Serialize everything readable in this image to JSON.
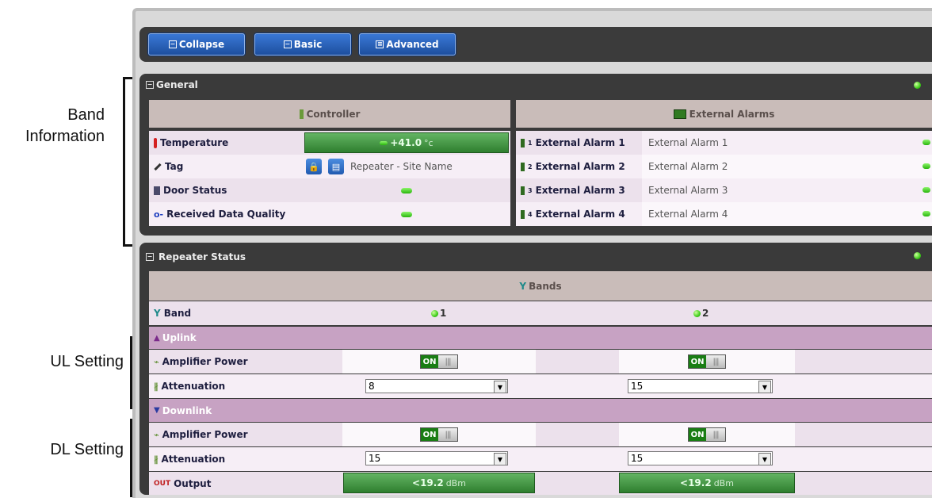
{
  "annotations": {
    "band_information": "Band\nInformation",
    "ul_setting": "UL Setting",
    "dl_setting": "DL Setting"
  },
  "toolbar": {
    "collapse_label": "Collapse",
    "basic_label": "Basic",
    "advanced_label": "Advanced"
  },
  "general": {
    "title": "General",
    "controller_header": "Controller",
    "external_alarms_header": "External Alarms",
    "temperature_label": "Temperature",
    "temperature_value": "+41.0",
    "temperature_unit": "°c",
    "tag_label": "Tag",
    "tag_value": "Repeater - Site Name",
    "door_status_label": "Door Status",
    "received_data_quality_label": "Received Data Quality",
    "alarms": [
      {
        "sup": "1",
        "label": "External Alarm 1",
        "value": "External Alarm 1"
      },
      {
        "sup": "2",
        "label": "External Alarm 2",
        "value": "External Alarm 2"
      },
      {
        "sup": "3",
        "label": "External Alarm 3",
        "value": "External Alarm 3"
      },
      {
        "sup": "4",
        "label": "External Alarm 4",
        "value": "External Alarm 4"
      }
    ]
  },
  "repeater": {
    "title": "Repeater Status",
    "bands_header": "Bands",
    "band_label": "Band",
    "band_1": "1",
    "band_2": "2",
    "uplink_label": "Uplink",
    "downlink_label": "Downlink",
    "ul_amp_label": "Amplifier Power",
    "ul_att_label": "Attenuation",
    "dl_amp_label": "Amplifier Power",
    "dl_att_label": "Attenuation",
    "output_label": "Output",
    "on_label": "ON",
    "ul_att_1": "8",
    "ul_att_2": "15",
    "dl_att_1": "15",
    "dl_att_2": "15",
    "output_1": "<19.2",
    "output_2": "<19.2",
    "output_unit": "dBm"
  },
  "colors": {
    "header_bar": "#3a3a3a",
    "button_blue": "#2a62c0",
    "status_green": "#3fce1a",
    "uplink_row": "#c7a2c3"
  }
}
